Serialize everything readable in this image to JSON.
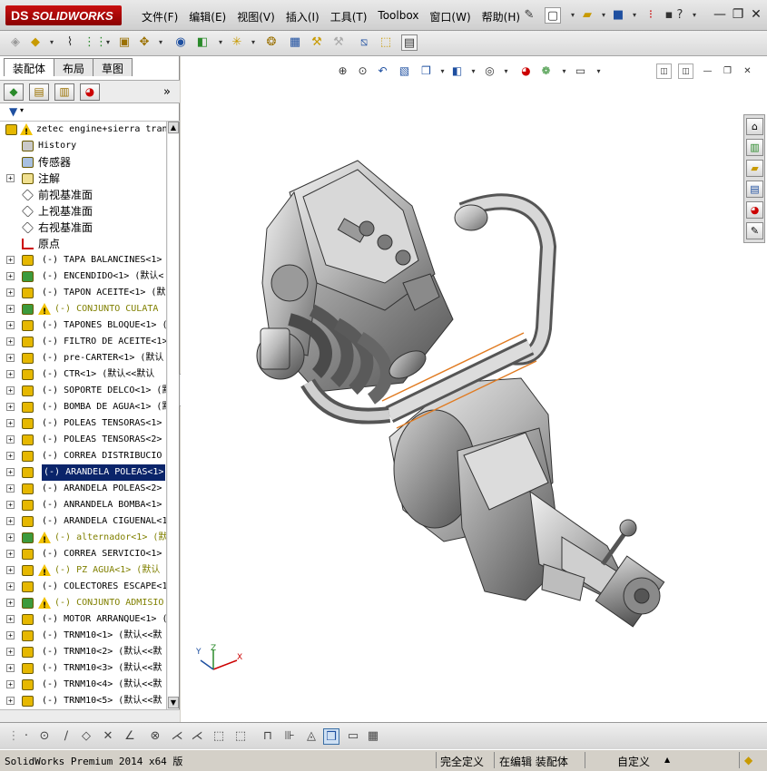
{
  "app": {
    "logo_ds": "DS",
    "logo_text": "SOLIDWORKS"
  },
  "menu": [
    "文件(F)",
    "编辑(E)",
    "视图(V)",
    "插入(I)",
    "工具(T)",
    "Toolbox",
    "窗口(W)",
    "帮助(H)"
  ],
  "window_controls": {
    "minimize": "—",
    "restore": "❐",
    "close": "✕"
  },
  "panel": {
    "tabs": [
      "装配体",
      "布局",
      "草图"
    ],
    "active_tab": 0,
    "more": "»",
    "filter_icon": "funnel-icon"
  },
  "tree": [
    {
      "label": "zetec engine+sierra tran",
      "warn": true,
      "kind": "root"
    },
    {
      "label": "History",
      "kind": "history"
    },
    {
      "label": "传感器",
      "kind": "sensor"
    },
    {
      "label": "注解",
      "kind": "annotation",
      "expand": true
    },
    {
      "label": "前视基准面",
      "kind": "plane"
    },
    {
      "label": "上视基准面",
      "kind": "plane"
    },
    {
      "label": "右视基准面",
      "kind": "plane"
    },
    {
      "label": "原点",
      "kind": "origin"
    },
    {
      "label": "(-) TAPA BALANCINES<1>",
      "kind": "part",
      "expand": true
    },
    {
      "label": "(-) ENCENDIDO<1> (默认<",
      "kind": "asm",
      "expand": true
    },
    {
      "label": "(-) TAPON ACEITE<1> (默",
      "kind": "part",
      "expand": true
    },
    {
      "label": "(-) CONJUNTO CULATA",
      "kind": "asm",
      "expand": true,
      "warn": true,
      "olive": true
    },
    {
      "label": "(-) TAPONES BLOQUE<1> (",
      "kind": "part",
      "expand": true
    },
    {
      "label": "(-) FILTRO DE ACEITE<1>",
      "kind": "part",
      "expand": true
    },
    {
      "label": "(-) pre-CARTER<1> (默认",
      "kind": "part",
      "expand": true
    },
    {
      "label": "(-) CTR<1> (默认<<默认",
      "kind": "part",
      "expand": true
    },
    {
      "label": "(-) SOPORTE DELCO<1> (默",
      "kind": "part",
      "expand": true
    },
    {
      "label": "(-) BOMBA DE AGUA<1> (默",
      "kind": "part",
      "expand": true
    },
    {
      "label": "(-) POLEAS TENSORAS<1>",
      "kind": "part",
      "expand": true
    },
    {
      "label": "(-) POLEAS TENSORAS<2>",
      "kind": "part",
      "expand": true
    },
    {
      "label": "(-) CORREA DISTRIBUCIO",
      "kind": "part",
      "expand": true
    },
    {
      "label": "(-) ARANDELA POLEAS<1>",
      "kind": "part",
      "expand": true,
      "selected": true
    },
    {
      "label": "(-) ARANDELA POLEAS<2>",
      "kind": "part",
      "expand": true
    },
    {
      "label": "(-) ANRANDELA BOMBA<1>",
      "kind": "part",
      "expand": true
    },
    {
      "label": "(-) ARANDELA CIGUENAL<1",
      "kind": "part",
      "expand": true
    },
    {
      "label": "(-) alternador<1> (默",
      "kind": "asm",
      "expand": true,
      "warn": true,
      "olive": true
    },
    {
      "label": "(-) CORREA SERVICIO<1>",
      "kind": "part",
      "expand": true
    },
    {
      "label": "(-) PZ AGUA<1> (默认",
      "kind": "part",
      "expand": true,
      "warn": true,
      "olive": true
    },
    {
      "label": "(-) COLECTORES ESCAPE<1",
      "kind": "part",
      "expand": true
    },
    {
      "label": "(-) CONJUNTO ADMISIO",
      "kind": "asm",
      "expand": true,
      "warn": true,
      "olive": true
    },
    {
      "label": "(-) MOTOR ARRANQUE<1> (",
      "kind": "part",
      "expand": true
    },
    {
      "label": "(-) TRNM10<1> (默认<<默",
      "kind": "part",
      "expand": true
    },
    {
      "label": "(-) TRNM10<2> (默认<<默",
      "kind": "part",
      "expand": true
    },
    {
      "label": "(-) TRNM10<3> (默认<<默",
      "kind": "part",
      "expand": true
    },
    {
      "label": "(-) TRNM10<4> (默认<<默",
      "kind": "part",
      "expand": true
    },
    {
      "label": "(-) TRNM10<5> (默认<<默",
      "kind": "part",
      "expand": true
    }
  ],
  "triad": {
    "x": "X",
    "y": "Y",
    "z": "Z"
  },
  "status": {
    "product": "SolidWorks Premium 2014 x64 版",
    "definition": "完全定义",
    "editing": "在编辑 装配体",
    "units": "自定义",
    "units_arrow": "▲"
  },
  "colors": {
    "selection": "#0a246a",
    "warning": "#f2c200",
    "part": "#e6b800",
    "asm_green": "#3c9a3c",
    "tube_highlight": "#e07a20"
  }
}
